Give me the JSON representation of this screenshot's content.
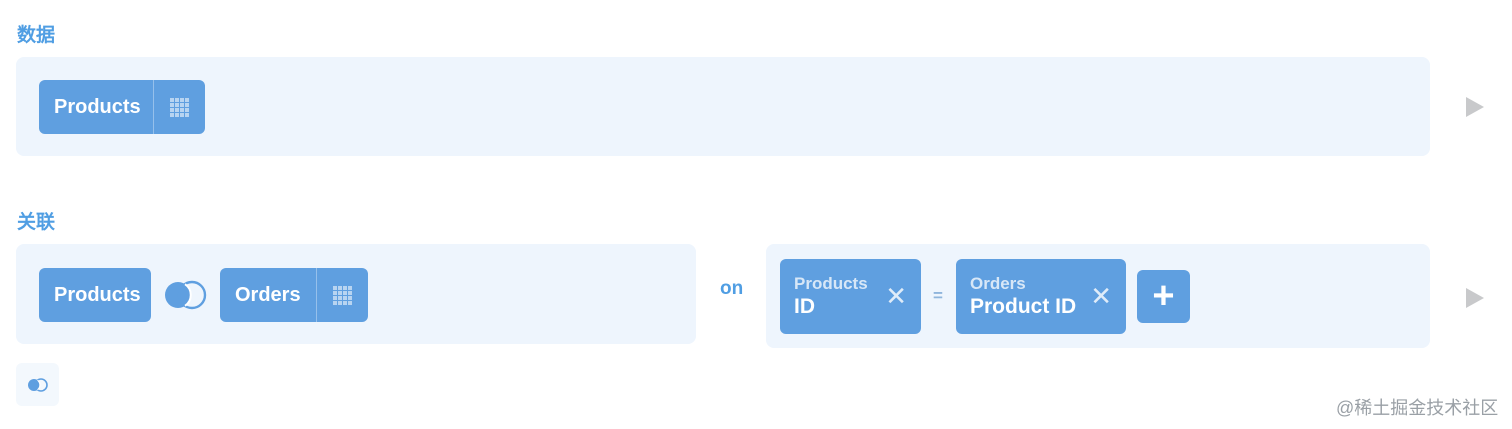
{
  "data_section": {
    "label": "数据",
    "source_table": {
      "label": "Products",
      "icon": "table-grid-icon"
    },
    "run_icon": "play-arrow-icon"
  },
  "join_section": {
    "label": "关联",
    "left_table": {
      "label": "Products"
    },
    "join_type_icon": "inner-join-icon",
    "right_table": {
      "label": "Orders",
      "icon": "table-grid-icon"
    },
    "on_label": "on",
    "condition": {
      "left": {
        "table": "Products",
        "column": "ID",
        "remove_icon": "close-icon"
      },
      "operator": "=",
      "right": {
        "table": "Orders",
        "column": "Product ID",
        "remove_icon": "close-icon"
      },
      "add_icon": "plus-icon"
    },
    "run_icon": "play-arrow-icon"
  },
  "extra_join_button_icon": "join-icon",
  "watermark": "@稀土掘金技术社区",
  "colors": {
    "accent": "#509ee3",
    "pill": "#5f9fe0",
    "panel": "#eef5fd",
    "arrow": "#c8c9cb"
  }
}
